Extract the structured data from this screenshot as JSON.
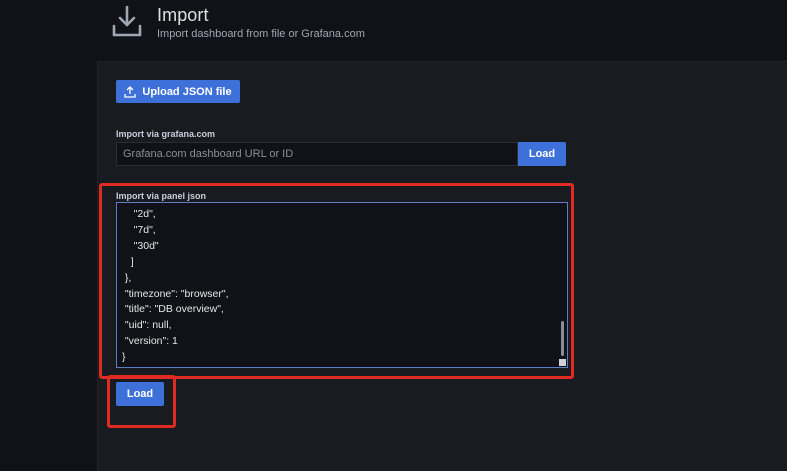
{
  "header": {
    "title": "Import",
    "subtitle": "Import dashboard from file or Grafana.com",
    "icon": "download-icon"
  },
  "upload": {
    "label": "Upload JSON file",
    "icon": "upload-icon"
  },
  "grafana_import": {
    "label": "Import via grafana.com",
    "placeholder": "Grafana.com dashboard URL or ID",
    "value": "",
    "button_label": "Load"
  },
  "json_import": {
    "label": "Import via panel json",
    "visible_text": "    \"2d\",\n    \"7d\",\n    \"30d\"\n   ]\n },\n \"timezone\": \"browser\",\n \"title\": \"DB overview\",\n \"uid\": null,\n \"version\": 1\n}"
  },
  "actions": {
    "load_label": "Load"
  },
  "colors": {
    "background": "#111217",
    "panel": "#181b1f",
    "primary_button": "#3d71d9",
    "highlight": "#e02b23",
    "textarea_border": "#5d7fbf"
  }
}
